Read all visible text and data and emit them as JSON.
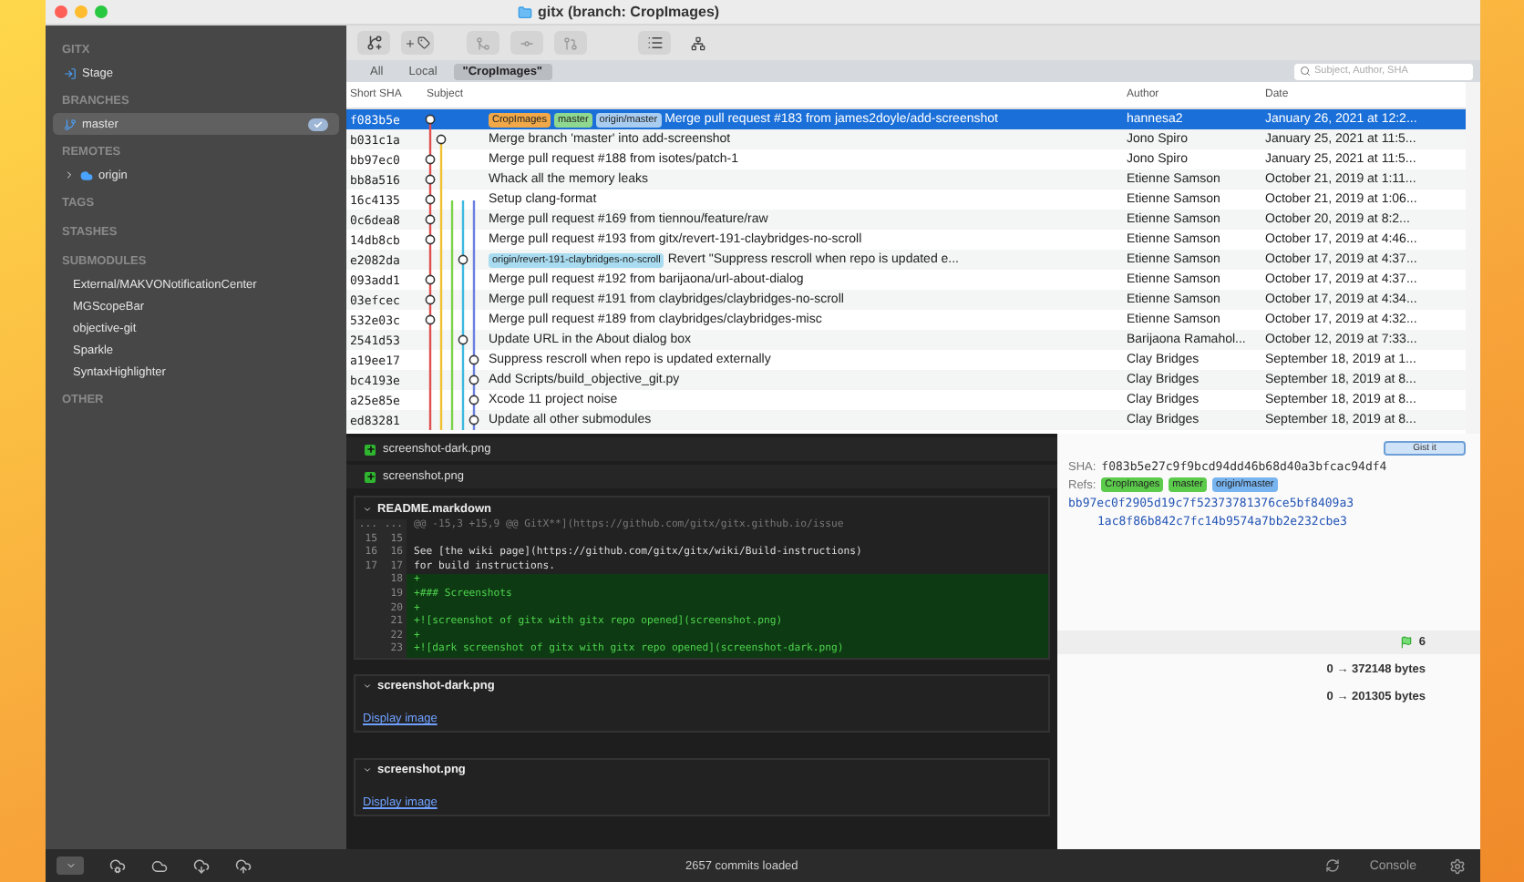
{
  "window": {
    "title": "gitx (branch: CropImages)"
  },
  "sidebar": {
    "sections": [
      {
        "heading": "GITX",
        "items": [
          {
            "label": "Stage",
            "kind": "stage",
            "selected": false
          }
        ]
      },
      {
        "heading": "BRANCHES",
        "items": [
          {
            "label": "master",
            "kind": "branch",
            "selected": true
          }
        ]
      },
      {
        "heading": "REMOTES",
        "items": [
          {
            "label": "origin",
            "kind": "remote",
            "selected": false,
            "expanded": false
          }
        ]
      },
      {
        "heading": "TAGS"
      },
      {
        "heading": "STASHES"
      },
      {
        "heading": "SUBMODULES",
        "items": [
          {
            "label": "External/MAKVONotificationCenter",
            "kind": "submodule",
            "selected": false
          },
          {
            "label": "MGScopeBar",
            "kind": "submodule",
            "selected": false
          },
          {
            "label": "objective-git",
            "kind": "submodule",
            "selected": false
          },
          {
            "label": "Sparkle",
            "kind": "submodule",
            "selected": false
          },
          {
            "label": "SyntaxHighlighter",
            "kind": "submodule",
            "selected": false
          }
        ]
      },
      {
        "heading": "OTHER"
      }
    ]
  },
  "scope_bar": {
    "scopes": [
      {
        "label": "All",
        "selected": false
      },
      {
        "label": "Local",
        "selected": false
      },
      {
        "label": "\"CropImages\"",
        "selected": true
      }
    ],
    "search": {
      "placeholder": "Subject, Author, SHA"
    }
  },
  "table": {
    "columns": [
      "Short SHA",
      "Subject",
      "Author",
      "Date"
    ],
    "rows": [
      {
        "sha": "f083b5e",
        "refs": [
          {
            "label": "CropImages",
            "color": "#f0a848"
          },
          {
            "label": "master",
            "color": "#8fd88f"
          },
          {
            "label": "origin/master",
            "color": "#a9cdf0"
          }
        ],
        "subject": "Merge pull request #183 from james2doyle/add-screenshot",
        "author": "hannesa2",
        "date": "January 26, 2021 at 12:2...",
        "selected": true
      },
      {
        "sha": "b031c1a",
        "refs": [],
        "subject": "Merge branch 'master' into add-screenshot",
        "author": "Jono Spiro",
        "date": "January 25, 2021 at 11:5...",
        "selected": false
      },
      {
        "sha": "bb97ec0",
        "refs": [],
        "subject": "Merge pull request #188 from isotes/patch-1",
        "author": "Jono Spiro",
        "date": "January 25, 2021 at 11:5...",
        "selected": false
      },
      {
        "sha": "bb8a516",
        "refs": [],
        "subject": "Whack all the memory leaks",
        "author": "Etienne Samson",
        "date": "October 21, 2019 at 1:11...",
        "selected": false
      },
      {
        "sha": "16c4135",
        "refs": [],
        "subject": "Setup clang-format",
        "author": "Etienne Samson",
        "date": "October 21, 2019 at 1:06...",
        "selected": false
      },
      {
        "sha": "0c6dea8",
        "refs": [],
        "subject": "Merge pull request #169 from tiennou/feature/raw",
        "author": "Etienne Samson",
        "date": "October 20, 2019 at 8:2...",
        "selected": false
      },
      {
        "sha": "14db8cb",
        "refs": [],
        "subject": "Merge pull request #193 from gitx/revert-191-claybridges-no-scroll",
        "author": "Etienne Samson",
        "date": "October 17, 2019 at 4:46...",
        "selected": false
      },
      {
        "sha": "e2082da",
        "refs": [
          {
            "label": "origin/revert-191-claybridges-no-scroll",
            "color": "#a9dcf0"
          }
        ],
        "subject": "Revert \"Suppress rescroll when repo is updated e...",
        "author": "Etienne Samson",
        "date": "October 17, 2019 at 4:37...",
        "selected": false
      },
      {
        "sha": "093add1",
        "refs": [],
        "subject": "Merge pull request #192 from barijaona/url-about-dialog",
        "author": "Etienne Samson",
        "date": "October 17, 2019 at 4:37...",
        "selected": false
      },
      {
        "sha": "03efcec",
        "refs": [],
        "subject": "Merge pull request #191 from claybridges/claybridges-no-scroll",
        "author": "Etienne Samson",
        "date": "October 17, 2019 at 4:34...",
        "selected": false
      },
      {
        "sha": "532e03c",
        "refs": [],
        "subject": "Merge pull request #189 from claybridges/claybridges-misc",
        "author": "Etienne Samson",
        "date": "October 17, 2019 at 4:32...",
        "selected": false
      },
      {
        "sha": "2541d53",
        "refs": [],
        "subject": "Update URL in the About dialog box",
        "author": "Barijaona Ramahol...",
        "date": "October 12, 2019 at 7:33...",
        "selected": false
      },
      {
        "sha": "a19ee17",
        "refs": [],
        "subject": "Suppress rescroll when repo is updated externally",
        "author": "Clay Bridges",
        "date": "September 18, 2019 at 1...",
        "selected": false
      },
      {
        "sha": "bc4193e",
        "refs": [],
        "subject": "Add Scripts/build_objective_git.py",
        "author": "Clay Bridges",
        "date": "September 18, 2019 at 8...",
        "selected": false
      },
      {
        "sha": "a25e85e",
        "refs": [],
        "subject": "Xcode 11 project noise",
        "author": "Clay Bridges",
        "date": "September 18, 2019 at 8...",
        "selected": false
      },
      {
        "sha": "ed83281",
        "refs": [],
        "subject": "Update all other submodules",
        "author": "Clay Bridges",
        "date": "September 18, 2019 at 8...",
        "selected": false
      }
    ]
  },
  "changed_files": [
    "screenshot-dark.png",
    "screenshot.png"
  ],
  "diff": {
    "file": "README.markdown",
    "lines": [
      {
        "kind": "hunk",
        "old": "...",
        "new": "...",
        "text": "@@ -15,3 +15,9 @@ GitX**](https://github.com/gitx/gitx.github.io/issue"
      },
      {
        "kind": "context",
        "old": "15",
        "new": "15"
      },
      {
        "kind": "context",
        "old": "16",
        "new": "16",
        "text": "See [the wiki page](https://github.com/gitx/gitx/wiki/Build-instructions)"
      },
      {
        "kind": "context",
        "old": "17",
        "new": "17",
        "text": "for build instructions."
      },
      {
        "kind": "added",
        "new": "18",
        "text": "+"
      },
      {
        "kind": "added",
        "new": "19",
        "text": "+### Screenshots"
      },
      {
        "kind": "added",
        "new": "20",
        "text": "+"
      },
      {
        "kind": "added",
        "new": "21",
        "text": "+![screenshot of gitx with gitx repo opened](screenshot.png)"
      },
      {
        "kind": "added",
        "new": "22",
        "text": "+"
      },
      {
        "kind": "added",
        "new": "23",
        "text": "+![dark screenshot of gitx with gitx repo opened](screenshot-dark.png)"
      }
    ]
  },
  "image_sections": [
    {
      "file": "screenshot-dark.png",
      "link": "Display image"
    },
    {
      "file": "screenshot.png",
      "link": "Display image"
    }
  ],
  "commit_info": {
    "gist_button": "Gist it",
    "sha_label": "SHA:",
    "sha": "f083b5e27c9f9bcd94dd46b68d40a3bfcac94df4",
    "refs_label": "Refs:",
    "refs": [
      {
        "label": "CropImages",
        "color": "#5ccb4c"
      },
      {
        "label": "master",
        "color": "#5ccb4c"
      },
      {
        "label": "origin/master",
        "color": "#78b4f0"
      }
    ],
    "parents": [
      "bb97ec0f2905d19c7f52373781376ce5bf8409a3",
      "1ac8f86b842c7fc14b9574a7bb2e232cbe3"
    ],
    "file_count": "6",
    "sizes": [
      "0 → 372148 bytes",
      "0 → 201305 bytes"
    ]
  },
  "status_bar": {
    "text": "2657 commits loaded",
    "console": "Console"
  }
}
